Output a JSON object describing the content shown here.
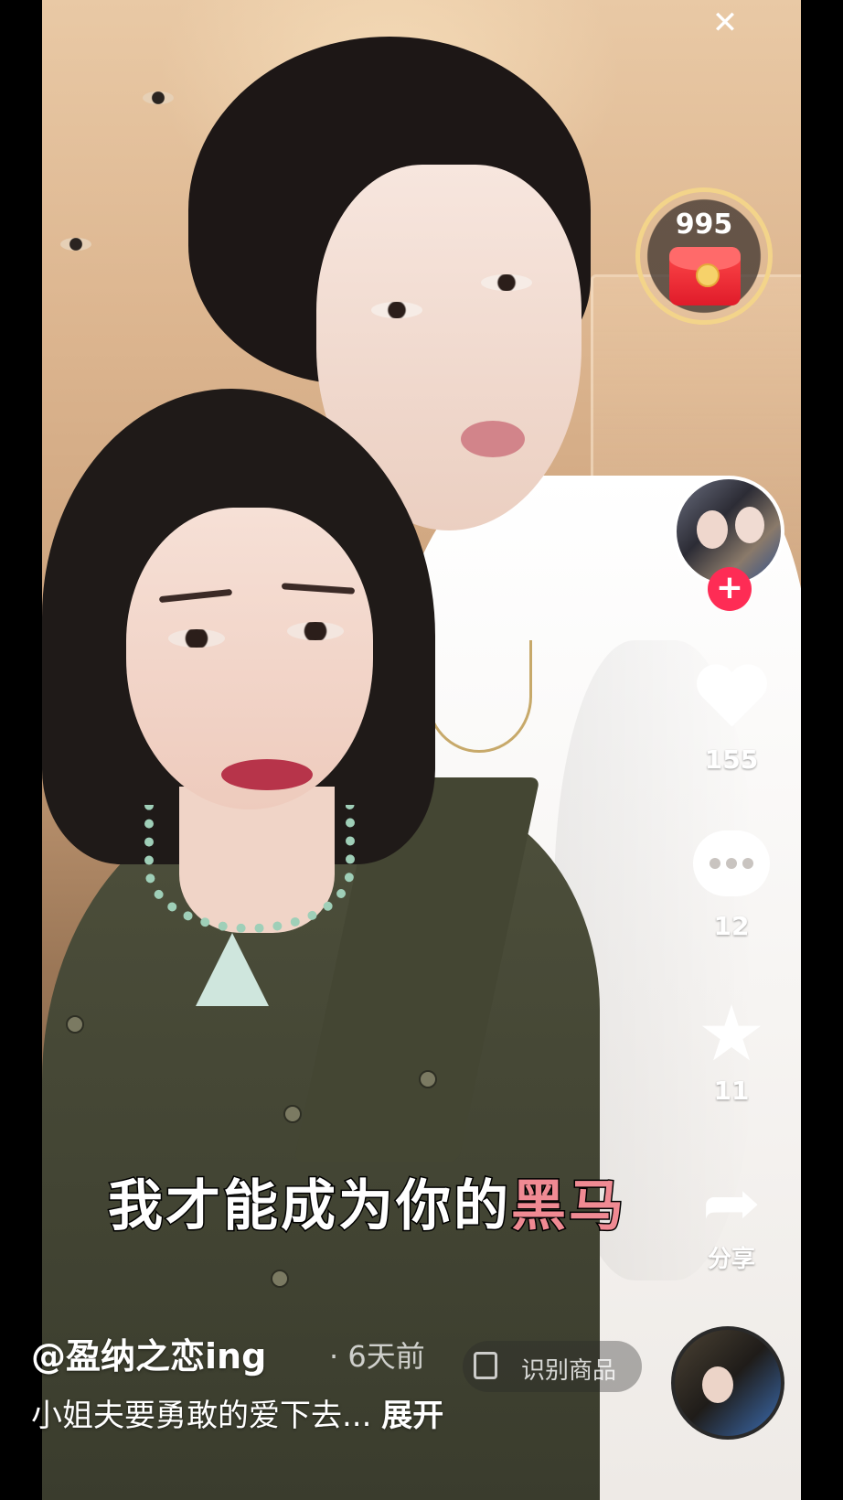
{
  "red_packet": {
    "count": "995"
  },
  "caption": {
    "main": "我才能成为你的",
    "highlight": "黑马"
  },
  "actions": {
    "like_count": "155",
    "comment_count": "12",
    "favorite_count": "11",
    "share_label": "分享"
  },
  "post": {
    "author": "@盈纳之恋ing",
    "time": "· 6天前",
    "description": "小姐夫要勇敢的爱下去...",
    "expand_label": "展开",
    "shop_label": "识别商品"
  },
  "icons": {
    "close": "close-icon",
    "follow": "plus-icon",
    "like": "heart-icon",
    "comment": "comment-icon",
    "favorite": "star-icon",
    "share": "share-icon"
  },
  "colors": {
    "accent": "#fe2c55",
    "highlight": "#f08a93",
    "packet": "#e01b2a"
  }
}
